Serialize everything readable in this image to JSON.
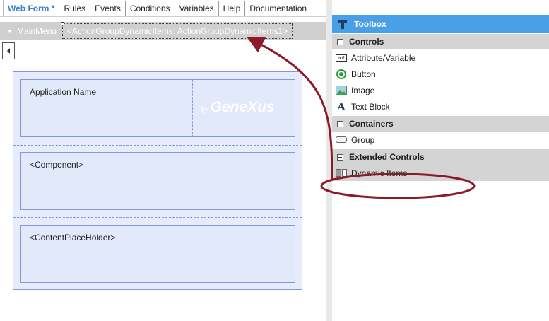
{
  "editor": {
    "tabs": [
      {
        "label": "Web Form *",
        "active": true
      },
      {
        "label": "Rules",
        "active": false
      },
      {
        "label": "Events",
        "active": false
      },
      {
        "label": "Conditions",
        "active": false
      },
      {
        "label": "Variables",
        "active": false
      },
      {
        "label": "Help",
        "active": false
      },
      {
        "label": "Documentation",
        "active": false
      }
    ],
    "menubar": {
      "main_menu": "MainMenu",
      "action_group": "<ActionGroupDynamicItems: ActionGroupDynamicItems1>"
    },
    "form": {
      "application_name": "Application Name",
      "logo_by": "by",
      "logo_name": "GeneXus",
      "component": "<Component>",
      "content_placeholder": "<ContentPlaceHolder>"
    }
  },
  "toolbox": {
    "title": "Toolbox",
    "accent_color": "#4aa0e6",
    "sections": [
      {
        "label": "Controls",
        "items": [
          {
            "label": "Attribute/Variable",
            "icon": "attribute-variable-icon"
          },
          {
            "label": "Button",
            "icon": "button-icon"
          },
          {
            "label": "Image",
            "icon": "image-icon"
          },
          {
            "label": "Text Block",
            "icon": "text-block-icon"
          }
        ]
      },
      {
        "label": "Containers",
        "items": [
          {
            "label": "Group",
            "icon": "group-icon"
          }
        ]
      },
      {
        "label": "Extended Controls",
        "items": [
          {
            "label": "Dynamic Items",
            "icon": "dynamic-items-icon",
            "selected": true
          }
        ]
      }
    ]
  },
  "annotation": {
    "color": "#8b1a2b",
    "shape": "ellipse-with-arrow"
  }
}
